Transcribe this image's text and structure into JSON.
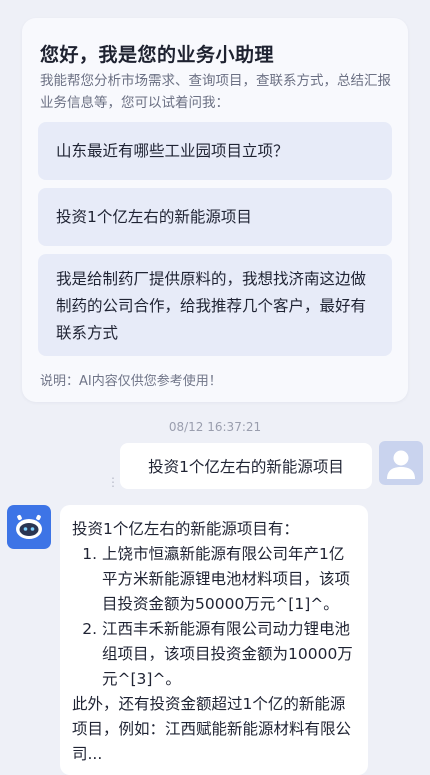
{
  "welcome": {
    "title": "您好，我是您的业务小助理",
    "description": "我能帮您分析市场需求、查询项目，查联系方式，总结汇报业务信息等，您可以试着问我：",
    "suggestions": [
      "山东最近有哪些工业园项目立项？",
      "投资1个亿左右的新能源项目",
      "我是给制药厂提供原料的，我想找济南这边做制药的公司合作，给我推荐几个客户，最好有联系方式"
    ],
    "disclaimer": "说明：AI内容仅供您参考使用！"
  },
  "chat": {
    "timestamp": "08/12 16:37:21",
    "user_message": "投资1个亿左右的新能源项目",
    "message_menu_icon": "⋮",
    "bot_reply": {
      "intro": "投资1个亿左右的新能源项目有：",
      "items": [
        "上饶市恒瀛新能源有限公司年产1亿平方米新能源锂电池材料项目，该项目投资金额为50000万元^[1]^。",
        "江西丰禾新能源有限公司动力锂电池组项目，该项目投资金额为10000万元^[3]^。"
      ],
      "outro": "此外，还有投资金额超过1个亿的新能源项目，例如：江西赋能新能源材料有限公司..."
    }
  },
  "icons": {
    "user_avatar": "user-avatar-icon",
    "bot_avatar": "robot-avatar-icon"
  },
  "colors": {
    "background": "#eef0f7",
    "suggestion_bg": "#e7ebf8",
    "bot_avatar_bg": "#3d74e6",
    "user_avatar_bg": "#c9d3ee"
  }
}
